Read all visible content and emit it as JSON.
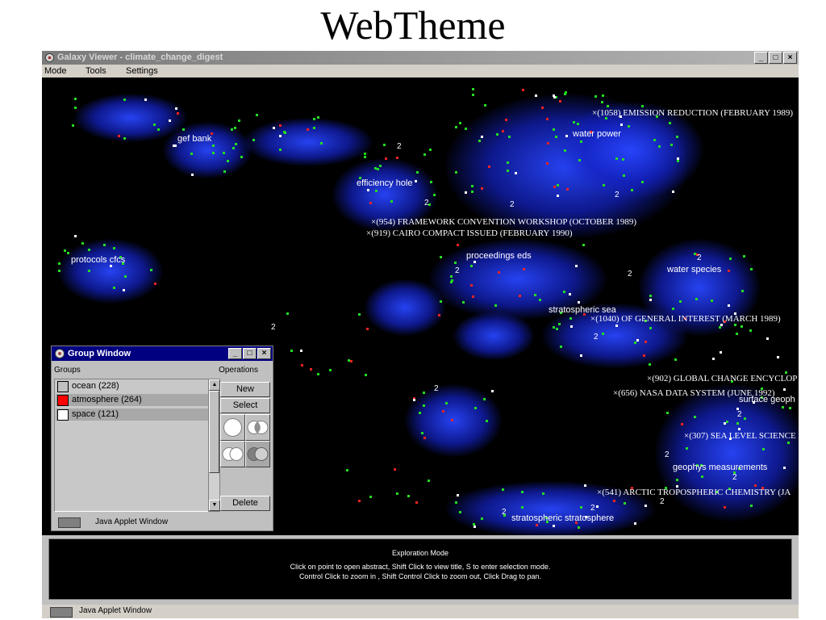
{
  "slide": {
    "title": "WebTheme"
  },
  "window": {
    "title": "Galaxy Viewer - climate_change_digest",
    "buttons": {
      "minimize": "_",
      "maximize": "□",
      "close": "×"
    }
  },
  "menu": {
    "items": [
      "Mode",
      "Tools",
      "Settings"
    ]
  },
  "canvas": {
    "labels": {
      "gef_bank": "gef bank",
      "efficiency_hole": "efficiency hole",
      "water_power": "water power",
      "protocols_cfcs": "protocols cfcs",
      "proceedings_eds": "proceedings eds",
      "water_species": "water species",
      "stratospheric_sea": "stratospheric sea",
      "surface_geoph": "surface geoph",
      "geophys_measurements": "geophys measurements",
      "stratospheric_stratosphere": "stratospheric stratosphere"
    },
    "titles": {
      "t1058": "(1058)  EMISSION REDUCTION (FEBRUARY 1989)",
      "t954": "(954)  FRAMEWORK CONVENTION WORKSHOP (OCTOBER 1989)",
      "t919": "(919)  CAIRO COMPACT ISSUED (FEBRUARY 1990)",
      "t1040": "(1040)  OF GENERAL INTEREST (MARCH 1989)",
      "t902": "(902)  GLOBAL CHANGE ENCYCLOP",
      "t656": "(656)  NASA DATA SYSTEM (JUNE 1992)",
      "t307": "(307)  SEA LEVEL SCIENCE",
      "t541": "(541)  ARCTIC TROPOSPHERIC CHEMISTRY (JA"
    },
    "marker": "2"
  },
  "info_panel": {
    "mode": "Exploration Mode",
    "line1": "Click on point to open abstract, Shift Click to view title, S to enter selection mode.",
    "line2": "Control Click to zoom in , Shift Control Click to zoom out, Click Drag to pan."
  },
  "taskbar": {
    "label": "Java Applet Window"
  },
  "group_window": {
    "title": "Group Window",
    "groups_header": "Groups",
    "operations_header": "Operations",
    "groups": [
      {
        "label": "ocean (228)",
        "color": "#c0c0c0"
      },
      {
        "label": "atmosphere (264)",
        "color": "#ff0000"
      },
      {
        "label": "space (121)",
        "color": "#ffffff"
      }
    ],
    "new_button": "New",
    "select_button": "Select",
    "delete_button": "Delete",
    "status_label": "Java Applet Window"
  },
  "colors": {
    "background": "#000000",
    "theme_glow": "#2846ff",
    "point_green": "#22dd22",
    "point_red": "#ee2222",
    "point_white": "#ffffff"
  }
}
